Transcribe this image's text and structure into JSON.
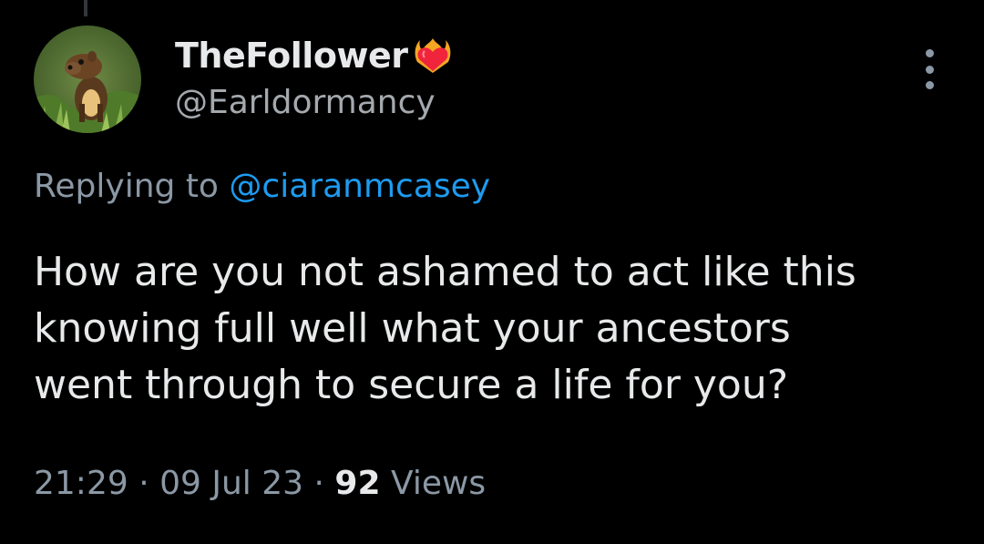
{
  "tweet": {
    "author": {
      "display_name": "TheFollower",
      "handle": "@Earldormancy",
      "badge_icon": "heart-on-fire-icon",
      "avatar_icon": "pine-marten-avatar"
    },
    "replying_to_label": "Replying to",
    "replying_to_handle": "@ciaranmcasey",
    "text_lines": [
      "How are you not ashamed to act like this",
      "knowing full well what your ancestors",
      "went through to secure a life for you?"
    ],
    "time": "21:29",
    "separator": "·",
    "date": "09 Jul 23",
    "views_count": "92",
    "views_label": "Views",
    "more_icon": "more-vertical-icon"
  },
  "colors": {
    "background": "#000000",
    "primary_text": "#e7e9ea",
    "secondary_text": "#8b98a5",
    "link": "#1d9bf0"
  }
}
